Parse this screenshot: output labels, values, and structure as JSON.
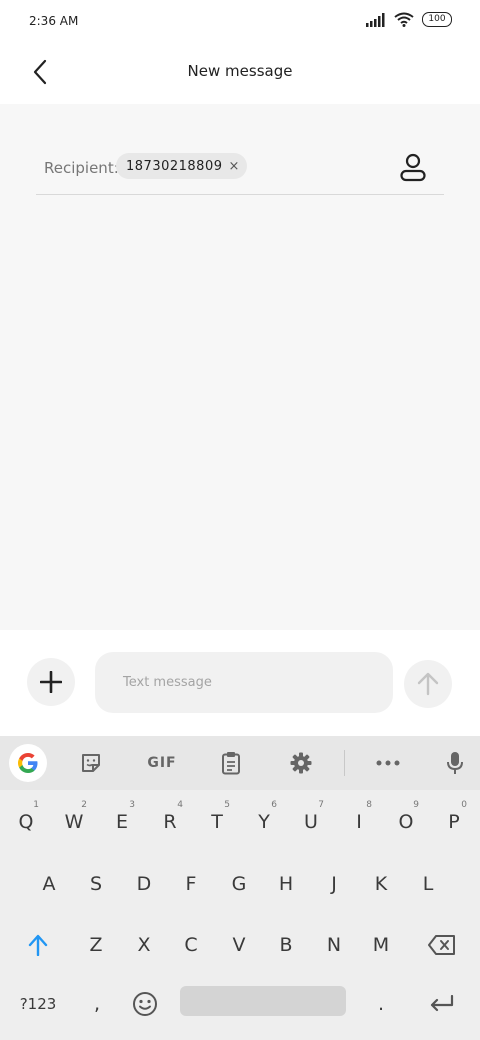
{
  "status_bar": {
    "time": "2:36 AM",
    "battery": "100"
  },
  "header": {
    "title": "New message"
  },
  "recipient": {
    "label": "Recipient:",
    "number": "18730218809",
    "remove_symbol": "×"
  },
  "compose": {
    "placeholder": "Text message"
  },
  "keyboard_toolbar": {
    "gif_label": "GIF"
  },
  "keyboard": {
    "row1": [
      {
        "label": "Q",
        "hint": "1"
      },
      {
        "label": "W",
        "hint": "2"
      },
      {
        "label": "E",
        "hint": "3"
      },
      {
        "label": "R",
        "hint": "4"
      },
      {
        "label": "T",
        "hint": "5"
      },
      {
        "label": "Y",
        "hint": "6"
      },
      {
        "label": "U",
        "hint": "7"
      },
      {
        "label": "I",
        "hint": "8"
      },
      {
        "label": "O",
        "hint": "9"
      },
      {
        "label": "P",
        "hint": "0"
      }
    ],
    "row2": [
      "A",
      "S",
      "D",
      "F",
      "G",
      "H",
      "J",
      "K",
      "L"
    ],
    "row3": [
      "Z",
      "X",
      "C",
      "V",
      "B",
      "N",
      "M"
    ],
    "row4": {
      "symbols": "?123",
      "comma": ",",
      "period": "."
    }
  },
  "colors": {
    "shift_blue": "#2196f3",
    "background": "#f7f7f7",
    "keyboard_bg": "#eeeeee"
  }
}
